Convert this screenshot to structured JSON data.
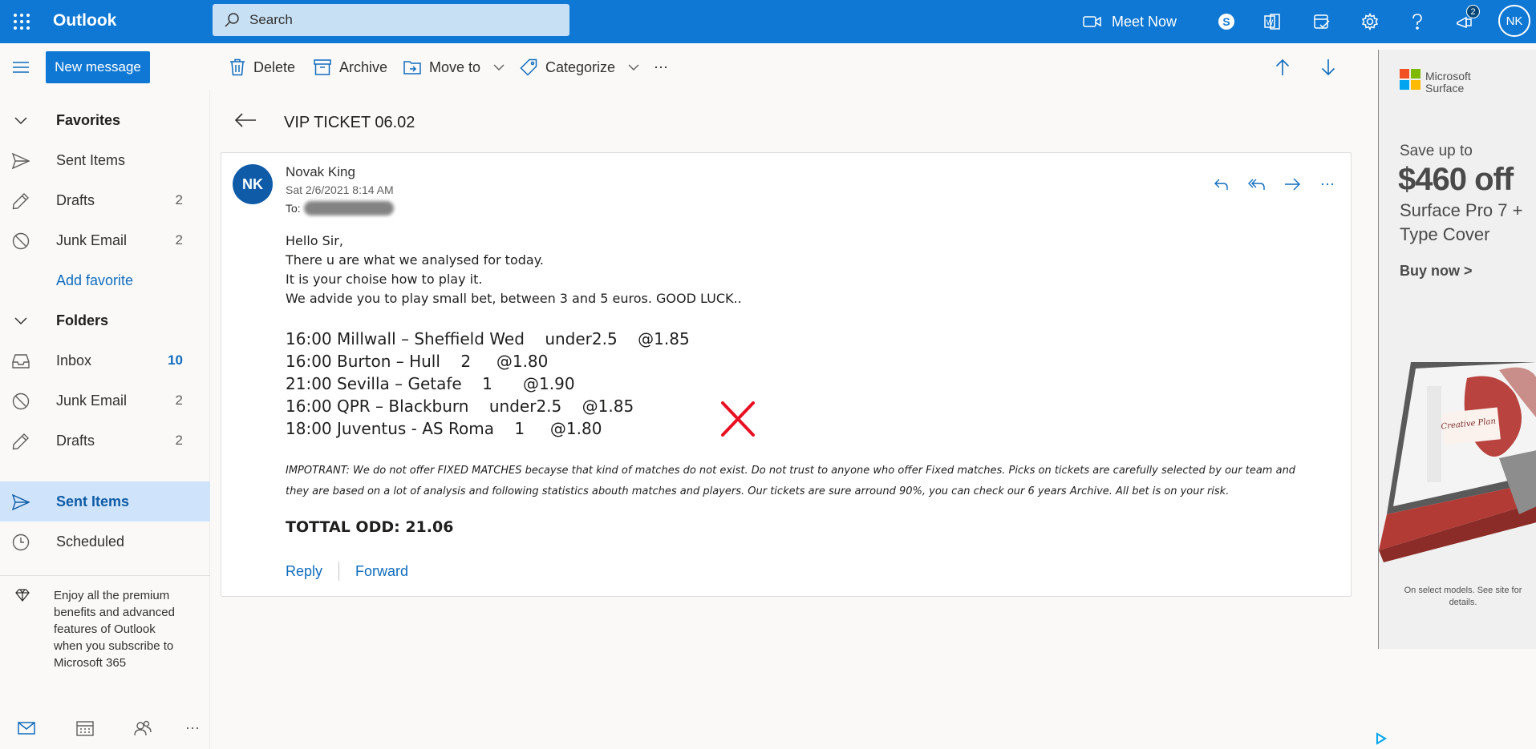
{
  "app": {
    "brand": "Outlook",
    "search_placeholder": "Search",
    "meet_now": "Meet Now",
    "notification_count": "2",
    "user_initials": "NK"
  },
  "toolbar": {
    "new_message": "New message",
    "delete": "Delete",
    "archive": "Archive",
    "move_to": "Move to",
    "categorize": "Categorize",
    "more": "⋯"
  },
  "nav": {
    "favorites_header": "Favorites",
    "favorites": [
      {
        "label": "Sent Items",
        "count": ""
      },
      {
        "label": "Drafts",
        "count": "2"
      },
      {
        "label": "Junk Email",
        "count": "2"
      }
    ],
    "add_favorite": "Add favorite",
    "folders_header": "Folders",
    "folders": [
      {
        "label": "Inbox",
        "count": "10"
      },
      {
        "label": "Junk Email",
        "count": "2"
      },
      {
        "label": "Drafts",
        "count": "2"
      },
      {
        "label": "Sent Items",
        "count": ""
      },
      {
        "label": "Scheduled",
        "count": ""
      }
    ],
    "promo_text": "Enjoy all the premium benefits and advanced features of Outlook when you subscribe to Microsoft 365"
  },
  "message": {
    "subject": "VIP TICKET 06.02",
    "sender_initials": "NK",
    "sender": "Novak King",
    "date": "Sat 2/6/2021 8:14 AM",
    "to_label": "To:",
    "greeting_lines": [
      "Hello Sir,",
      "There u are what we analysed for today.",
      "It is your choise how to play it.",
      "We advide you to play small bet, between 3 and 5 euros. GOOD LUCK.."
    ],
    "picks": [
      "16:00 Millwall – Sheffield Wed    under2.5    @1.85",
      "16:00 Burton – Hull    2     @1.80",
      "21:00 Sevilla – Getafe    1      @1.90",
      "16:00 QPR – Blackburn    under2.5    @1.85",
      "18:00 Juventus - AS Roma    1     @1.80"
    ],
    "important": "IMPOTRANT: We do not offer FIXED MATCHES becayse that kind of matches do not exist. Do not trust to anyone who offer Fixed matches. Picks on tickets are carefully selected by our team and they are based on a lot of analysis and following statistics abouth matches and players. Our tickets are sure arround 90%, you can check our 6 years Archive. All bet is on your risk.",
    "total": "TOTTAL ODD: 21.06",
    "reply": "Reply",
    "forward": "Forward"
  },
  "ad": {
    "brand_line1": "Microsoft",
    "brand_line2": "Surface",
    "save": "Save up to",
    "price": "$460 off",
    "product": "Surface Pro 7 + Type Cover",
    "cta": "Buy now >",
    "fine_print": "On select models. See site for details.",
    "screen_title": "Creative Plan"
  },
  "colors": {
    "accent": "#0f78d4",
    "selected_bg": "#cfe4fa",
    "link": "#0f6cbd",
    "mark_red": "#e81123"
  }
}
